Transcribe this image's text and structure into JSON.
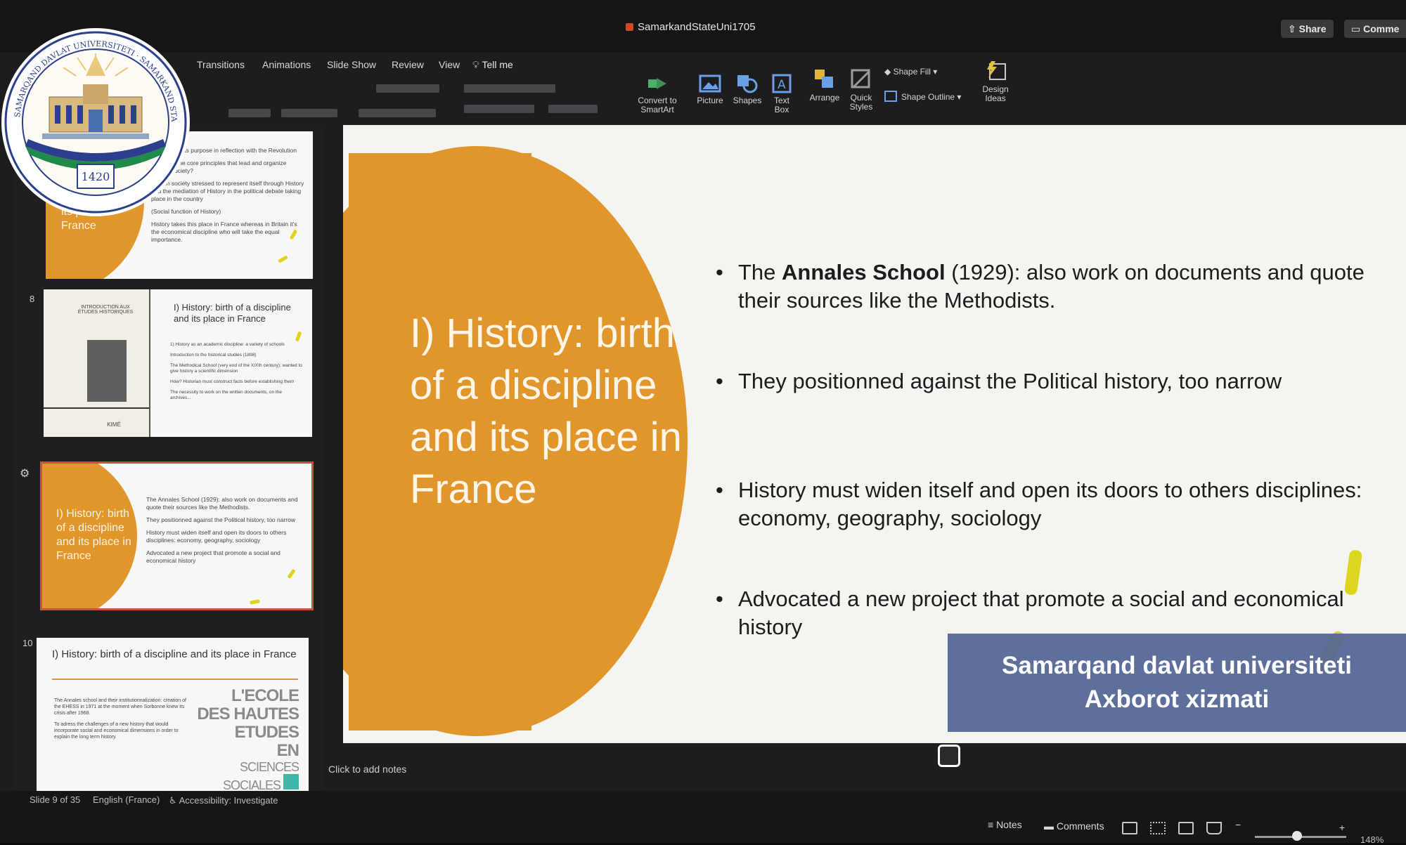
{
  "window": {
    "doc_title": "SamarkandStateUni1705",
    "share_label": "Share",
    "comments_label": "Comme"
  },
  "menu_tabs": [
    "Transitions",
    "Animations",
    "Slide Show",
    "Review",
    "View",
    "Tell me"
  ],
  "ribbon": {
    "convert_label_1": "Convert to",
    "convert_label_2": "SmartArt",
    "picture_label": "Picture",
    "shapes_label": "Shapes",
    "textbox_label_1": "Text",
    "textbox_label_2": "Box",
    "arrange_label": "Arrange",
    "quickstyles_label_1": "Quick",
    "quickstyles_label_2": "Styles",
    "shape_fill_label": "Shape Fill",
    "shape_outline_label": "Shape Outline",
    "design_ideas_label_1": "Design",
    "design_ideas_label_2": "Ideas"
  },
  "thumbnails": {
    "slide7": {
      "title": "discipline and its place in France",
      "bullets": [
        "France and its purpose in reflection with the Revolution",
        "What are the core principles that lead and organize French society?",
        "French society stressed to represent itself through History and the mediation of History in the political debate taking place in the country",
        "(Social function of History)",
        "History takes this place in France whereas in Britain it's the economical discipline who will take the equal importance."
      ]
    },
    "slide8": {
      "number": "8",
      "title": "I) History: birth of a discipline and its place in France",
      "book_title": "INTRODUCTION AUX ÉTUDES HISTORIQUES",
      "book_publisher": "KIMÉ",
      "bullets": [
        "1) History as an academic discipline: a variety of schools",
        "Introduction to the historical studies (1898)",
        "The Methodical School (very end of the XIXth century): wanted to give history a scientific dimension",
        "How? Historian must construct facts before establishing them",
        "The necessity to work on the written documents, on the archives..."
      ]
    },
    "slide9": {
      "title": "I) History: birth of a discipline and its place in France",
      "bullets": [
        "The Annales School (1929): also work on documents and quote their sources like the Methodists.",
        "They positionned against the Political history, too narrow",
        "History must widen itself and open its doors to others disciplines: economy, geography, sociology",
        "Advocated a new project that promote a social and economical history"
      ]
    },
    "slide10": {
      "number": "10",
      "title": "I) History: birth of a discipline and its place in France",
      "bullets": [
        "The Annales school and their institutionnalization: creation of the EHESS in 1971 at the moment when Sorbonne knew its crisis after 1968.",
        "To adress the challenges of a new history that would incorporate social and economical dimensions in order to explain the long term history."
      ],
      "ecole_lines": [
        "L'ECOLE",
        "DES HAUTES",
        "ETUDES",
        "EN",
        "SCIENCES",
        "SOCIALES"
      ]
    }
  },
  "slide": {
    "title": "I) History: birth of a discipline and its place in France",
    "bullet1_pre": "The ",
    "bullet1_bold": "Annales School",
    "bullet1_post": " (1929): also work on documents and quote their sources like the Methodists.",
    "bullet2": "They positionned against the Political history, too narrow",
    "bullet3": "History must widen itself and open its doors to others disciplines: economy, geography, sociology",
    "bullet4": "Advocated a new project that promote a social and economical history"
  },
  "notes_placeholder": "Click to add notes",
  "status": {
    "slide_counter": "Slide 9 of 35",
    "language": "English (France)",
    "accessibility": "Accessibility: Investigate",
    "notes_label": "Notes",
    "comments_label": "Comments",
    "zoom": "148%"
  },
  "watermark": {
    "line1": "Samarqand davlat universiteti",
    "line2": "Axborot xizmati"
  },
  "logo": {
    "text_top": "SAMARQAND DAVLAT UNIVERSITETI · SAMARKAND STATE UNIVERSITY",
    "year": "1420"
  },
  "colors": {
    "slide_orange": "#e1962b",
    "accent_yellow": "#dcd61f",
    "watermark_blue": "#546696",
    "app_dark": "#1d1d1f"
  }
}
